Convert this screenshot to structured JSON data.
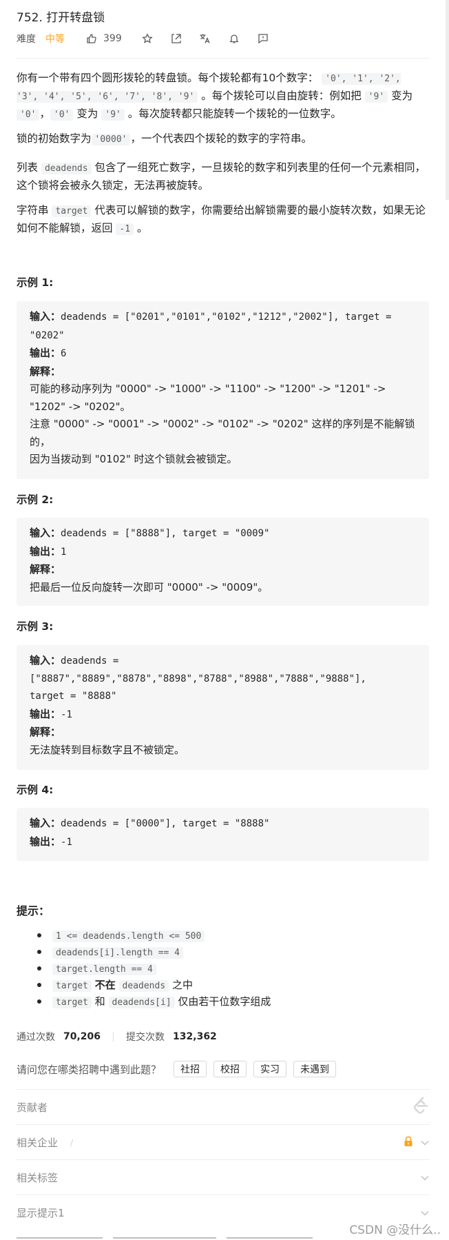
{
  "problem": {
    "title": "752. 打开转盘锁",
    "difficulty_label": "难度",
    "difficulty": "中等",
    "likes": "399"
  },
  "icons": [
    "thumb-up-icon",
    "star-icon",
    "share-icon",
    "translate-icon",
    "bell-icon",
    "feedback-icon"
  ],
  "description": {
    "p1_a": "你有一个带有四个圆形拨轮的转盘锁。每个拨轮都有10个数字：",
    "p1_digits": "'0', '1', '2', '3', '4', '5', '6', '7', '8', '9'",
    "p1_b": "。每个拨轮可以自由旋转：例如把",
    "p1_c": "变为",
    "p1_d": "，",
    "p1_e": "变为",
    "p1_f": "。每次旋转都只能旋转一个拨轮的一位数字。",
    "code_9": "'9'",
    "code_0": "'0'",
    "p2_a": "锁的初始数字为",
    "p2_code": "'0000'",
    "p2_b": "，一个代表四个拨轮的数字的字符串。",
    "p3_a": "列表",
    "p3_code": "deadends",
    "p3_b": "包含了一组死亡数字，一旦拨轮的数字和列表里的任何一个元素相同，这个锁将会被永久锁定，无法再被旋转。",
    "p4_a": "字符串",
    "p4_code": "target",
    "p4_b": "代表可以解锁的数字，你需要给出解锁需要的最小旋转次数，如果无论如何不能解锁，返回",
    "p4_code2": "-1",
    "p4_c": "。"
  },
  "examples": [
    {
      "title": "示例 1:",
      "input_label": "输入：",
      "input_value": "deadends = [\"0201\",\"0101\",\"0102\",\"1212\",\"2002\"], target = \"0202\"",
      "output_label": "输出：",
      "output_value": "6",
      "explain_label": "解释：",
      "explain_line1": "可能的移动序列为 \"0000\" -> \"1000\" -> \"1100\" -> \"1200\" -> \"1201\" -> \"1202\" -> \"0202\"。",
      "explain_line2": "注意 \"0000\" -> \"0001\" -> \"0002\" -> \"0102\" -> \"0202\" 这样的序列是不能解锁的，",
      "explain_line3": "因为当拨动到 \"0102\" 时这个锁就会被锁定。"
    },
    {
      "title": "示例 2:",
      "input_label": "输入：",
      "input_value": "deadends = [\"8888\"], target = \"0009\"",
      "output_label": "输出：",
      "output_value": "1",
      "explain_label": "解释：",
      "explain_line1": "把最后一位反向旋转一次即可 \"0000\" -> \"0009\"。"
    },
    {
      "title": "示例 3:",
      "input_label": "输入：",
      "input_value_1": "deadends =",
      "input_value_2": "[\"8887\",\"8889\",\"8878\",\"8898\",\"8788\",\"8988\",\"7888\",\"9888\"],",
      "input_value_3": "target = \"8888\"",
      "output_label": "输出：",
      "output_value": "-1",
      "explain_label": "解释：",
      "explain_line1": "无法旋转到目标数字且不被锁定。"
    },
    {
      "title": "示例 4:",
      "input_label": "输入：",
      "input_value": "deadends = [\"0000\"], target = \"8888\"",
      "output_label": "输出：",
      "output_value": "-1"
    }
  ],
  "tips": {
    "title": "提示：",
    "t1": "1 <=  deadends.length <= 500",
    "t2": "deadends[i].length == 4",
    "t3": "target.length == 4",
    "t4_code1": "target",
    "t4_bold": "不在",
    "t4_code2": "deadends",
    "t4_text": "之中",
    "t5_code1": "target",
    "t5_and": "和",
    "t5_code2": "deadends[i]",
    "t5_text": "仅由若干位数字组成"
  },
  "stats": {
    "accepted_label": "通过次数",
    "accepted": "70,206",
    "submissions_label": "提交次数",
    "submissions": "132,362"
  },
  "interview": {
    "question": "请问您在哪类招聘中遇到此题？",
    "options": [
      "社招",
      "校招",
      "实习",
      "未遇到"
    ]
  },
  "sections": {
    "contributors": "贡献者",
    "companies": "相关企业",
    "companies_sep": "/",
    "tags": "相关标签",
    "hint": "显示提示1"
  },
  "watermark": "CSDN @没什么.."
}
